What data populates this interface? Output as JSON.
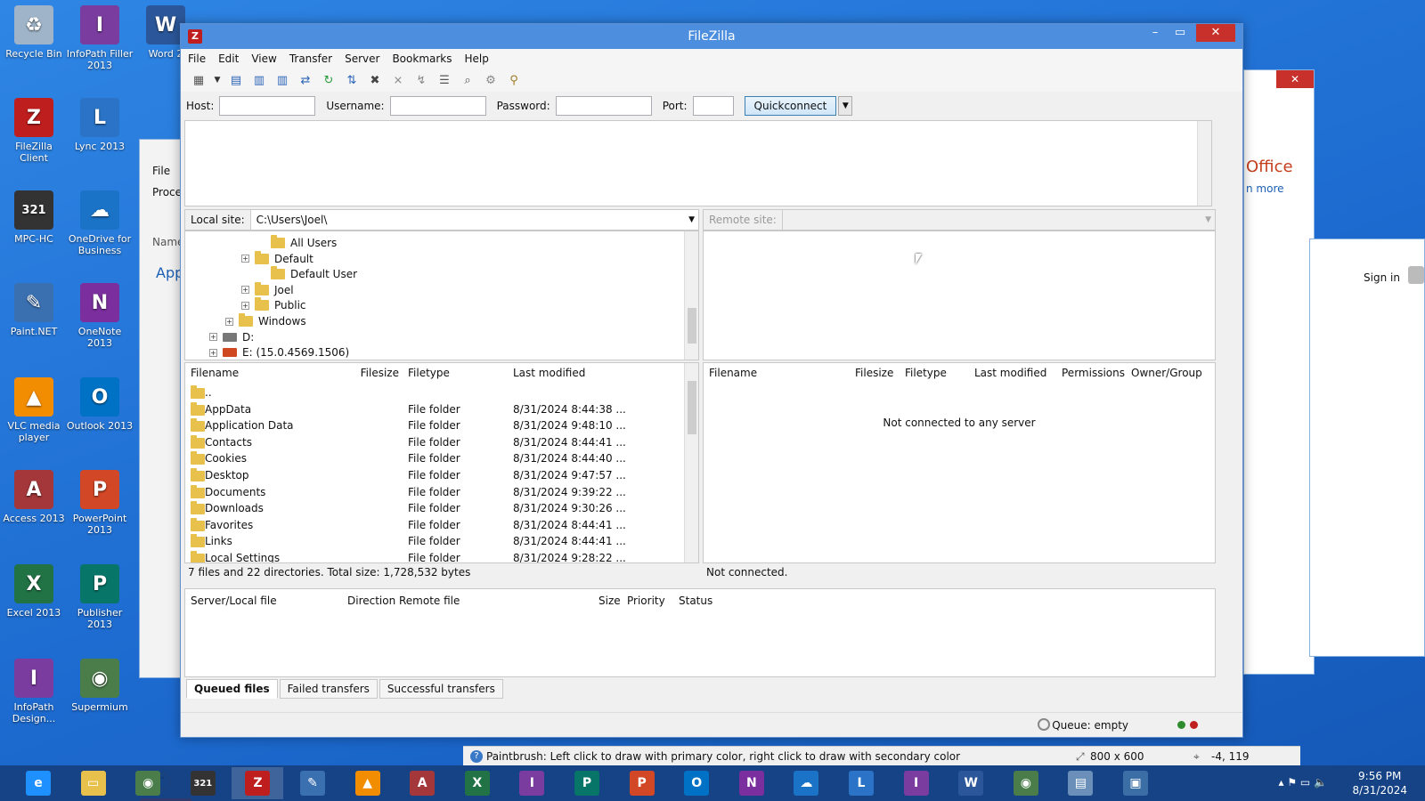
{
  "desktop": {
    "icons": [
      {
        "label": "Recycle Bin",
        "icon": "recycle-bin-icon",
        "color": "#9fb4c8",
        "glyph": "♻"
      },
      {
        "label": "InfoPath Filler 2013",
        "icon": "infopath-icon",
        "color": "#7a3c9e",
        "glyph": "I"
      },
      {
        "label": "Word 2",
        "icon": "word-icon",
        "color": "#2b579a",
        "glyph": "W"
      },
      {
        "label": "FileZilla Client",
        "icon": "filezilla-icon",
        "color": "#bf1e1e",
        "glyph": "Z"
      },
      {
        "label": "Lync 2013",
        "icon": "lync-icon",
        "color": "#2a73c6",
        "glyph": "L"
      },
      {
        "label": "MPC-HC",
        "icon": "mpc-hc-icon",
        "color": "#333333",
        "glyph": "321"
      },
      {
        "label": "OneDrive for Business",
        "icon": "onedrive-icon",
        "color": "#1a73c6",
        "glyph": "☁"
      },
      {
        "label": "Paint.NET",
        "icon": "paintnet-icon",
        "color": "#3a6fb0",
        "glyph": "✎"
      },
      {
        "label": "OneNote 2013",
        "icon": "onenote-icon",
        "color": "#7b2f9e",
        "glyph": "N"
      },
      {
        "label": "VLC media player",
        "icon": "vlc-icon",
        "color": "#f28c00",
        "glyph": "▲"
      },
      {
        "label": "Outlook 2013",
        "icon": "outlook-icon",
        "color": "#0072c6",
        "glyph": "O"
      },
      {
        "label": "Access 2013",
        "icon": "access-icon",
        "color": "#a4373a",
        "glyph": "A"
      },
      {
        "label": "PowerPoint 2013",
        "icon": "powerpoint-icon",
        "color": "#d24726",
        "glyph": "P"
      },
      {
        "label": "Excel 2013",
        "icon": "excel-icon",
        "color": "#217346",
        "glyph": "X"
      },
      {
        "label": "Publisher 2013",
        "icon": "publisher-icon",
        "color": "#077568",
        "glyph": "P"
      },
      {
        "label": "InfoPath Design...",
        "icon": "infopath-designer-icon",
        "color": "#7a3c9e",
        "glyph": "I"
      },
      {
        "label": "Supermium",
        "icon": "supermium-icon",
        "color": "#4a7d4a",
        "glyph": "◉"
      }
    ]
  },
  "background_windows": {
    "task_manager": {
      "menu": "File",
      "tab": "Proce",
      "col": "Name",
      "group": "App"
    },
    "office": {
      "title": "Office",
      "link": "n more"
    },
    "signin": {
      "label": "Sign in"
    }
  },
  "filezilla": {
    "title": "FileZilla",
    "menu": [
      "File",
      "Edit",
      "View",
      "Transfer",
      "Server",
      "Bookmarks",
      "Help"
    ],
    "quickconnect": {
      "host_label": "Host:",
      "host_value": "",
      "username_label": "Username:",
      "username_value": "",
      "password_label": "Password:",
      "password_value": "",
      "port_label": "Port:",
      "port_value": "",
      "button": "Quickconnect"
    },
    "local": {
      "site_label": "Local site:",
      "site_path": "C:\\Users\\Joel\\",
      "tree": [
        {
          "label": "All Users",
          "expander": ""
        },
        {
          "label": "Default",
          "expander": "+"
        },
        {
          "label": "Default User",
          "expander": ""
        },
        {
          "label": "Joel",
          "expander": "+"
        },
        {
          "label": "Public",
          "expander": "+"
        },
        {
          "label": "Windows",
          "expander": "+"
        },
        {
          "label": "D:",
          "expander": "+"
        },
        {
          "label": "E: (15.0.4569.1506)",
          "expander": "+"
        }
      ],
      "columns": [
        "Filename",
        "Filesize",
        "Filetype",
        "Last modified"
      ],
      "files": [
        {
          "name": "..",
          "size": "",
          "type": "",
          "modified": ""
        },
        {
          "name": "AppData",
          "size": "",
          "type": "File folder",
          "modified": "8/31/2024 8:44:38 ..."
        },
        {
          "name": "Application Data",
          "size": "",
          "type": "File folder",
          "modified": "8/31/2024 9:48:10 ..."
        },
        {
          "name": "Contacts",
          "size": "",
          "type": "File folder",
          "modified": "8/31/2024 8:44:41 ..."
        },
        {
          "name": "Cookies",
          "size": "",
          "type": "File folder",
          "modified": "8/31/2024 8:44:40 ..."
        },
        {
          "name": "Desktop",
          "size": "",
          "type": "File folder",
          "modified": "8/31/2024 9:47:57 ..."
        },
        {
          "name": "Documents",
          "size": "",
          "type": "File folder",
          "modified": "8/31/2024 9:39:22 ..."
        },
        {
          "name": "Downloads",
          "size": "",
          "type": "File folder",
          "modified": "8/31/2024 9:30:26 ..."
        },
        {
          "name": "Favorites",
          "size": "",
          "type": "File folder",
          "modified": "8/31/2024 8:44:41 ..."
        },
        {
          "name": "Links",
          "size": "",
          "type": "File folder",
          "modified": "8/31/2024 8:44:41 ..."
        },
        {
          "name": "Local Settings",
          "size": "",
          "type": "File folder",
          "modified": "8/31/2024 9:28:22 ..."
        }
      ],
      "status": "7 files and 22 directories. Total size: 1,728,532 bytes"
    },
    "remote": {
      "site_label": "Remote site:",
      "site_path": "",
      "columns": [
        "Filename",
        "Filesize",
        "Filetype",
        "Last modified",
        "Permissions",
        "Owner/Group"
      ],
      "empty_message": "Not connected to any server",
      "status": "Not connected."
    },
    "queue": {
      "columns": [
        "Server/Local file",
        "Direction",
        "Remote file",
        "Size",
        "Priority",
        "Status"
      ],
      "tabs": [
        "Queued files",
        "Failed transfers",
        "Successful transfers"
      ],
      "status": "Queue: empty"
    }
  },
  "paint_status": {
    "hint": "Paintbrush: Left click to draw with primary color, right click to draw with secondary color",
    "size": "800 x 600",
    "coords": "-4, 119"
  },
  "taskbar": {
    "apps": [
      {
        "icon": "internet-explorer-icon",
        "color": "#1e90ff",
        "glyph": "e"
      },
      {
        "icon": "file-explorer-icon",
        "color": "#e8c14c",
        "glyph": "▭"
      },
      {
        "icon": "supermium-icon",
        "color": "#4a7d4a",
        "glyph": "◉"
      },
      {
        "icon": "mpc-hc-icon",
        "color": "#333333",
        "glyph": "321"
      },
      {
        "icon": "filezilla-icon",
        "color": "#bf1e1e",
        "glyph": "Z"
      },
      {
        "icon": "paintnet-icon",
        "color": "#3a6fb0",
        "glyph": "✎"
      },
      {
        "icon": "vlc-icon",
        "color": "#f28c00",
        "glyph": "▲"
      },
      {
        "icon": "access-icon",
        "color": "#a4373a",
        "glyph": "A"
      },
      {
        "icon": "excel-icon",
        "color": "#217346",
        "glyph": "X"
      },
      {
        "icon": "infopath-icon",
        "color": "#7a3c9e",
        "glyph": "I"
      },
      {
        "icon": "publisher-icon",
        "color": "#077568",
        "glyph": "P"
      },
      {
        "icon": "powerpoint-icon",
        "color": "#d24726",
        "glyph": "P"
      },
      {
        "icon": "outlook-icon",
        "color": "#0072c6",
        "glyph": "O"
      },
      {
        "icon": "onenote-icon",
        "color": "#7b2f9e",
        "glyph": "N"
      },
      {
        "icon": "onedrive-icon",
        "color": "#1a73c6",
        "glyph": "☁"
      },
      {
        "icon": "lync-icon",
        "color": "#2a73c6",
        "glyph": "L"
      },
      {
        "icon": "infopath-designer-icon",
        "color": "#7a3c9e",
        "glyph": "I"
      },
      {
        "icon": "word-icon",
        "color": "#2b579a",
        "glyph": "W"
      },
      {
        "icon": "supermium-icon",
        "color": "#4a7d4a",
        "glyph": "◉"
      },
      {
        "icon": "task-manager-icon",
        "color": "#6a8fb8",
        "glyph": "▤"
      },
      {
        "icon": "remote-desktop-icon",
        "color": "#3c6ea6",
        "glyph": "▣"
      }
    ],
    "time": "9:56 PM",
    "date": "8/31/2024"
  }
}
